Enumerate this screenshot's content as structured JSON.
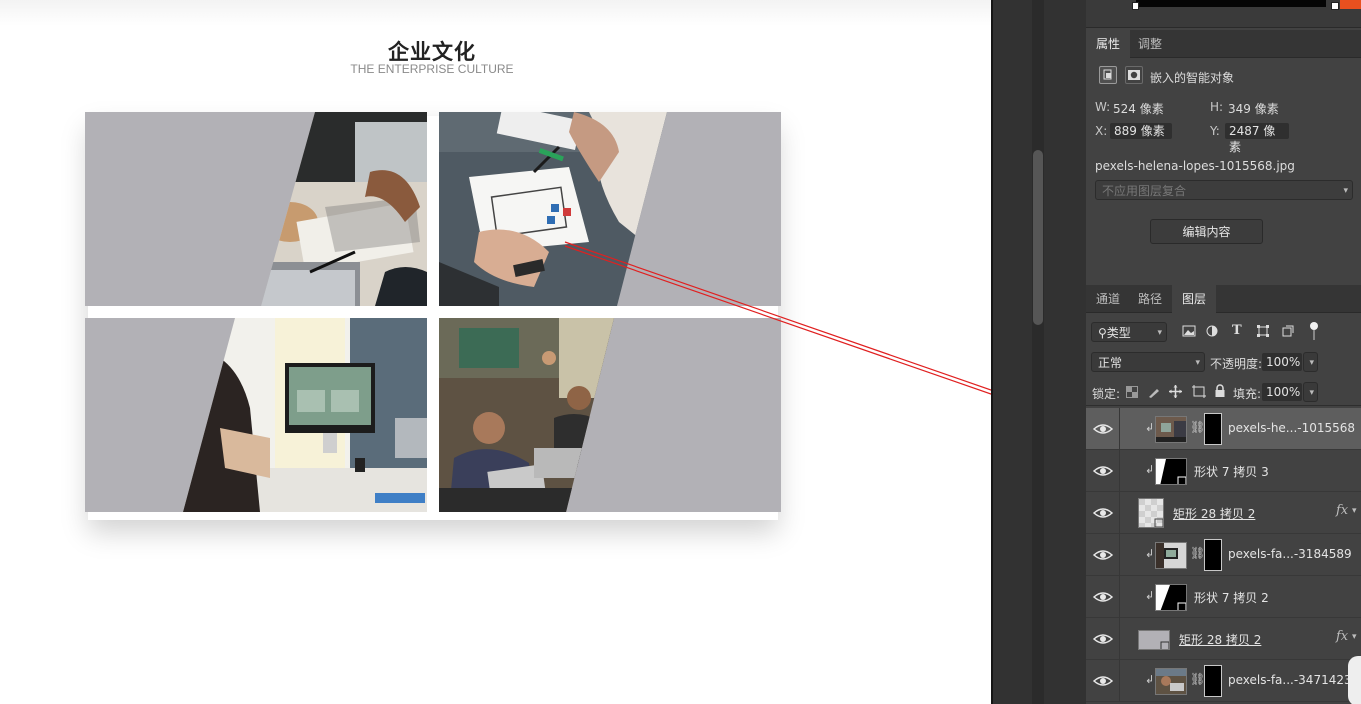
{
  "canvas": {
    "title": "企业文化",
    "subtitle": "THE ENTERPRISE CULTURE",
    "photo_cells": [
      {
        "name": "desk-notebook-laptop"
      },
      {
        "name": "sketching-app-icons"
      },
      {
        "name": "office-imac"
      },
      {
        "name": "cafe-laptop-team"
      }
    ]
  },
  "colors": {
    "cell_grey": "#b2b1b6",
    "arrow": "#e02020",
    "panel_bg": "#424242",
    "selected_row": "#5e5e5e"
  },
  "properties": {
    "tabs": [
      "属性",
      "调整"
    ],
    "object_type": "嵌入的智能对象",
    "w_label": "W:",
    "w_value": "524 像素",
    "h_label": "H:",
    "h_value": "349 像素",
    "x_label": "X:",
    "x_value": "889 像素",
    "y_label": "Y:",
    "y_value": "2487 像素",
    "filename": "pexels-helena-lopes-1015568.jpg",
    "comp_placeholder": "不应用图层复合",
    "edit_button": "编辑内容"
  },
  "layers_panel": {
    "tabs": [
      "通道",
      "路径",
      "图层"
    ],
    "active_tab": "图层",
    "filter_kind": "类型",
    "blend_mode": "正常",
    "opacity_label": "不透明度:",
    "opacity_value": "100%",
    "lock_label": "锁定:",
    "fill_label": "填充:",
    "fill_value": "100%",
    "clip_glyph": "↲",
    "link_glyph": "⛓",
    "fx_label": "fx",
    "layers": [
      {
        "name": "pexels-he...-1015568",
        "kind": "smart-object-clipped",
        "selected": true
      },
      {
        "name": "形状 7 拷贝 3",
        "kind": "shape-clipped"
      },
      {
        "name": "矩形 28 拷贝 2",
        "kind": "rect-with-fx"
      },
      {
        "name": "pexels-fa...-3184589",
        "kind": "smart-object-clipped"
      },
      {
        "name": "形状 7 拷贝 2",
        "kind": "shape-clipped"
      },
      {
        "name": "矩形 28 拷贝 2",
        "kind": "rect-with-fx"
      },
      {
        "name": "pexels-fa...-3471423",
        "kind": "smart-object-clipped"
      }
    ]
  }
}
